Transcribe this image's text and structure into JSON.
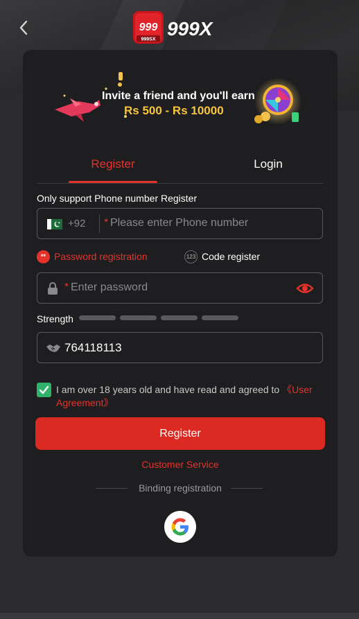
{
  "header": {
    "back_icon": "chevron-left-icon",
    "logo_badge_text": "999",
    "logo_badge_sub": "999SX",
    "logo_text": "999X"
  },
  "banner": {
    "line1": "Invite a friend and you'll earn",
    "line2": "Rs 500 - Rs 10000"
  },
  "tabs": [
    {
      "label": "Register",
      "active": true
    },
    {
      "label": "Login",
      "active": false
    }
  ],
  "form": {
    "section_label": "Only support Phone number Register",
    "country_code": "+92",
    "phone_placeholder": "Please enter Phone number",
    "required_mark": "*",
    "option_password_label": "Password registration",
    "option_password_icon_text": "**",
    "option_code_label": "Code register",
    "option_code_icon_text": "123",
    "password_placeholder": "Enter password",
    "strength_label": "Strength",
    "strength_level": 0,
    "invite_code_value": "764118113",
    "agree_checked": true,
    "agree_text": "I am over 18 years old and have read and agreed to ",
    "agree_link": "《User Agreement》",
    "register_button": "Register",
    "customer_service": "Customer Service",
    "binding_label": "Binding registration"
  },
  "colors": {
    "accent": "#e5322d",
    "button": "#da2a22",
    "checkbox": "#2fb36b",
    "card": "#1e1e20",
    "page": "#2b2b2d"
  }
}
